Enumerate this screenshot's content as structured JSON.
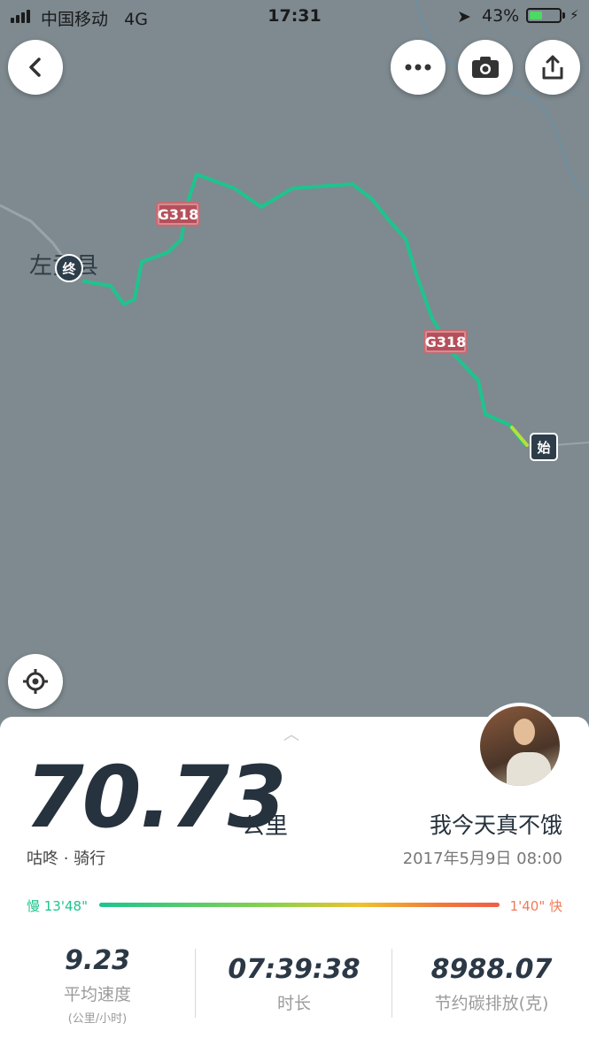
{
  "status_bar": {
    "carrier": "中国移动",
    "network": "4G",
    "time": "17:31",
    "battery_percent": "43%",
    "battery_level": 0.43
  },
  "map": {
    "town_label": "左贡县",
    "road_label_1": "G318",
    "road_label_2": "G318",
    "end_marker": "终",
    "start_marker": "始",
    "route_color": "#1ec48e",
    "icons": {
      "back": "back-chevron-icon",
      "more": "more-dots-icon",
      "camera": "camera-icon",
      "share": "share-icon",
      "locate": "locate-icon"
    }
  },
  "summary": {
    "distance": "70.73",
    "unit": "公里",
    "user_name": "我今天真不饿",
    "activity": "咕咚 · 骑行",
    "date": "2017年5月9日 08:00",
    "pace_slow_label": "慢 13'48\"",
    "pace_fast_label": "1'40\" 快"
  },
  "stats": [
    {
      "value": "9.23",
      "label": "平均速度",
      "sub": "(公里/小时)"
    },
    {
      "value": "07:39:38",
      "label": "时长"
    },
    {
      "value": "8988.07",
      "label": "节约碳排放(克)"
    }
  ]
}
